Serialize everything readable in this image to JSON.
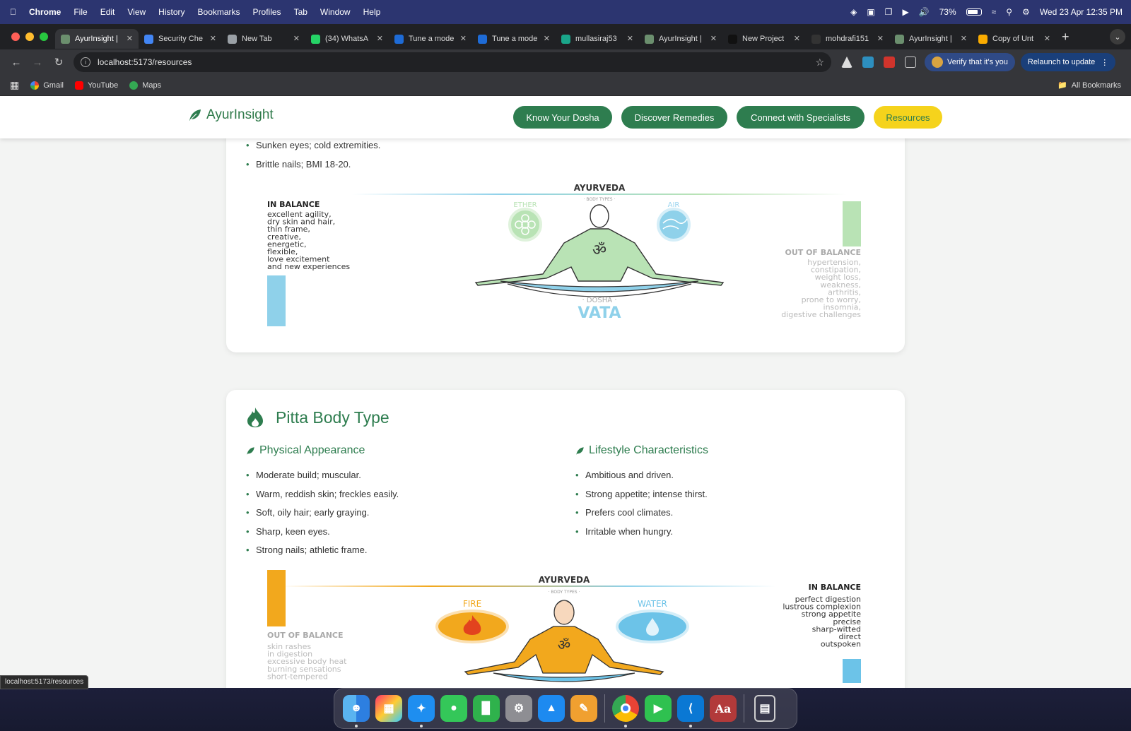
{
  "menubar": {
    "app": "Chrome",
    "items": [
      "File",
      "Edit",
      "View",
      "History",
      "Bookmarks",
      "Profiles",
      "Tab",
      "Window",
      "Help"
    ],
    "battery": "73%",
    "datetime": "Wed 23 Apr  12:35 PM"
  },
  "tabs": [
    {
      "title": "AyurInsight |",
      "icon": "ayurinsight-favicon",
      "color": "#6b8f6e"
    },
    {
      "title": "Security Che",
      "icon": "google-favicon",
      "color": "#4285f4"
    },
    {
      "title": "New Tab",
      "icon": "chrome-favicon",
      "color": "#9aa0a6"
    },
    {
      "title": "(34) WhatsA",
      "icon": "whatsapp-favicon",
      "color": "#25d366"
    },
    {
      "title": "Tune a mode",
      "icon": "butterfly-favicon",
      "color": "#1e6bd6"
    },
    {
      "title": "Tune a mode",
      "icon": "butterfly-favicon",
      "color": "#1e6bd6"
    },
    {
      "title": "mullasiraj53",
      "icon": "diamond-favicon",
      "color": "#1aa68a"
    },
    {
      "title": "AyurInsight |",
      "icon": "ayurinsight-favicon",
      "color": "#6b8f6e"
    },
    {
      "title": "New Project",
      "icon": "triangle-favicon",
      "color": "#111111"
    },
    {
      "title": "mohdrafi151",
      "icon": "github-favicon",
      "color": "#333333"
    },
    {
      "title": "AyurInsight |",
      "icon": "ayurinsight-favicon",
      "color": "#6b8f6e"
    },
    {
      "title": "Copy of Unt",
      "icon": "colab-favicon",
      "color": "#f9ab00"
    }
  ],
  "toolbar": {
    "url": "localhost:5173/resources",
    "verify": "Verify that it's you",
    "relaunch": "Relaunch to update"
  },
  "bookmarks": {
    "items": [
      "Gmail",
      "YouTube",
      "Maps"
    ],
    "all": "All Bookmarks"
  },
  "site": {
    "brand": "AyurInsight",
    "nav": [
      "Know Your Dosha",
      "Discover Remedies",
      "Connect with Specialists",
      "Resources"
    ],
    "accent": "#2e7d4f",
    "highlight": "#f5d31c"
  },
  "vata": {
    "tail_items": [
      "Sunken eyes; cold extremities.",
      "Brittle nails; BMI 18-20."
    ],
    "illustration": {
      "header": "AYURVEDA",
      "sub": "· BODY TYPES ·",
      "elem_left": "ETHER",
      "elem_right": "AIR",
      "dosha_label": "· DOSHA ·",
      "dosha": "VATA",
      "in_title": "IN BALANCE",
      "in_lines": [
        "excellent agility,",
        "dry skin and hair,",
        "thin frame,",
        "creative,",
        "energetic,",
        "flexible,",
        "love excitement",
        "and new experiences"
      ],
      "out_title": "OUT OF BALANCE",
      "out_lines": [
        "hypertension,",
        "constipation,",
        "weight loss,",
        "weakness,",
        "arthritis,",
        "prone to worry,",
        "insomnia,",
        "digestive challenges"
      ],
      "symbol": "ॐ"
    }
  },
  "pitta": {
    "title": "Pitta Body Type",
    "physical_heading": "Physical Appearance",
    "physical": [
      "Moderate build; muscular.",
      "Warm, reddish skin; freckles easily.",
      "Soft, oily hair; early graying.",
      "Sharp, keen eyes.",
      "Strong nails; athletic frame."
    ],
    "lifestyle_heading": "Lifestyle Characteristics",
    "lifestyle": [
      "Ambitious and driven.",
      "Strong appetite; intense thirst.",
      "Prefers cool climates.",
      "Irritable when hungry."
    ],
    "illustration": {
      "header": "AYURVEDA",
      "sub": "· BODY TYPES ·",
      "elem_left": "FIRE",
      "elem_right": "WATER",
      "out_title": "OUT OF BALANCE",
      "out_lines": [
        "skin rashes",
        "in digestion",
        "excessive body heat",
        "burning sensations",
        "short-tempered"
      ],
      "in_title": "IN BALANCE",
      "in_lines": [
        "perfect digestion",
        "lustrous complexion",
        "strong appetite",
        "precise",
        "sharp-witted",
        "direct",
        "outspoken"
      ],
      "symbol": "ॐ"
    }
  },
  "status_url": "localhost:5173/resources",
  "dock": [
    "Finder",
    "Launchpad",
    "Safari",
    "Messages",
    "Numbers",
    "System Settings",
    "Keynote",
    "Pages",
    "Chrome",
    "FaceTime",
    "VS Code",
    "Dictionary",
    "Trash"
  ]
}
